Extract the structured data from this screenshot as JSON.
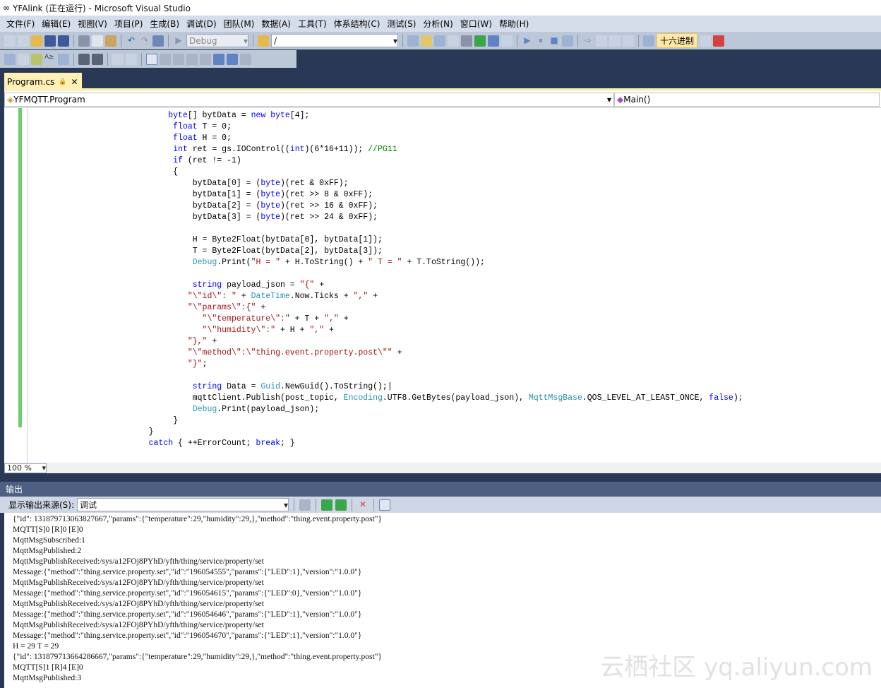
{
  "window": {
    "title": "YFAlink (正在运行) - Microsoft Visual Studio"
  },
  "menu": [
    "文件(F)",
    "编辑(E)",
    "视图(V)",
    "项目(P)",
    "生成(B)",
    "调试(D)",
    "团队(M)",
    "数据(A)",
    "工具(T)",
    "体系结构(C)",
    "测试(S)",
    "分析(N)",
    "窗口(W)",
    "帮助(H)"
  ],
  "toolbar": {
    "config": "Debug",
    "find": "/",
    "hex_label": "十六进制"
  },
  "tab": {
    "label": "Program.cs"
  },
  "navbar": {
    "class": "YFMQTT.Program",
    "member": "Main()"
  },
  "editor": {
    "zoom": "100 %",
    "lines": [
      [
        [
          "                            "
        ],
        [
          "byte",
          "kw"
        ],
        [
          "[] bytData = "
        ],
        [
          "new",
          "kw"
        ],
        [
          " "
        ],
        [
          "byte",
          "kw"
        ],
        [
          "[4];"
        ]
      ],
      [
        [
          "                             "
        ],
        [
          "float",
          "kw"
        ],
        [
          " T = 0;"
        ]
      ],
      [
        [
          "                             "
        ],
        [
          "float",
          "kw"
        ],
        [
          " H = 0;"
        ]
      ],
      [
        [
          "                             "
        ],
        [
          "int",
          "kw"
        ],
        [
          " ret = gs.IOControl(("
        ],
        [
          "int",
          "kw"
        ],
        [
          ")(6*16+11)); "
        ],
        [
          "//PG11",
          "cm"
        ]
      ],
      [
        [
          "                             "
        ],
        [
          "if",
          "kw"
        ],
        [
          " (ret != -1)"
        ]
      ],
      [
        [
          "                             {"
        ]
      ],
      [
        [
          "                                 bytData[0] = ("
        ],
        [
          "byte",
          "kw"
        ],
        [
          ")(ret & 0xFF);"
        ]
      ],
      [
        [
          "                                 bytData[1] = ("
        ],
        [
          "byte",
          "kw"
        ],
        [
          ")(ret >> 8 & 0xFF);"
        ]
      ],
      [
        [
          "                                 bytData[2] = ("
        ],
        [
          "byte",
          "kw"
        ],
        [
          ")(ret >> 16 & 0xFF);"
        ]
      ],
      [
        [
          "                                 bytData[3] = ("
        ],
        [
          "byte",
          "kw"
        ],
        [
          ")(ret >> 24 & 0xFF);"
        ]
      ],
      [
        [
          ""
        ]
      ],
      [
        [
          "                                 H = Byte2Float(bytData[0], bytData[1]);"
        ]
      ],
      [
        [
          "                                 T = Byte2Float(bytData[2], bytData[3]);"
        ]
      ],
      [
        [
          "                                 "
        ],
        [
          "Debug",
          "ty"
        ],
        [
          ".Print("
        ],
        [
          "\"H = \"",
          "str"
        ],
        [
          " + H.ToString() + "
        ],
        [
          "\" T = \"",
          "str"
        ],
        [
          " + T.ToString());"
        ]
      ],
      [
        [
          ""
        ]
      ],
      [
        [
          "                                 "
        ],
        [
          "string",
          "kw"
        ],
        [
          " payload_json = "
        ],
        [
          "\"{\"",
          "str"
        ],
        [
          " +"
        ]
      ],
      [
        [
          "                                "
        ],
        [
          "\"\\\"id\\\": \"",
          "str"
        ],
        [
          " + "
        ],
        [
          "DateTime",
          "ty"
        ],
        [
          ".Now.Ticks + "
        ],
        [
          "\",\"",
          "str"
        ],
        [
          " +"
        ]
      ],
      [
        [
          "                                "
        ],
        [
          "\"\\\"params\\\":{\"",
          "str"
        ],
        [
          " +"
        ]
      ],
      [
        [
          "                                   "
        ],
        [
          "\"\\\"temperature\\\":\"",
          "str"
        ],
        [
          " + T + "
        ],
        [
          "\",\"",
          "str"
        ],
        [
          " +"
        ]
      ],
      [
        [
          "                                   "
        ],
        [
          "\"\\\"humidity\\\":\"",
          "str"
        ],
        [
          " + H + "
        ],
        [
          "\",\"",
          "str"
        ],
        [
          " +"
        ]
      ],
      [
        [
          "                                "
        ],
        [
          "\"},\"",
          "str"
        ],
        [
          " +"
        ]
      ],
      [
        [
          "                                "
        ],
        [
          "\"\\\"method\\\":\\\"thing.event.property.post\\\"\"",
          "str"
        ],
        [
          " +"
        ]
      ],
      [
        [
          "                                "
        ],
        [
          "\"}\"",
          "str"
        ],
        [
          ";"
        ]
      ],
      [
        [
          ""
        ]
      ],
      [
        [
          "                                 "
        ],
        [
          "string",
          "kw"
        ],
        [
          " Data = "
        ],
        [
          "Guid",
          "ty"
        ],
        [
          ".NewGuid().ToString();|"
        ]
      ],
      [
        [
          "                                 mqttClient.Publish(post_topic, "
        ],
        [
          "Encoding",
          "ty"
        ],
        [
          ".UTF8.GetBytes(payload_json), "
        ],
        [
          "MqttMsgBase",
          "ty"
        ],
        [
          ".QOS_LEVEL_AT_LEAST_ONCE, "
        ],
        [
          "false",
          "kw"
        ],
        [
          ");"
        ]
      ],
      [
        [
          "                                 "
        ],
        [
          "Debug",
          "ty"
        ],
        [
          ".Print(payload_json);"
        ]
      ],
      [
        [
          "                             }"
        ]
      ],
      [
        [
          "                        }"
        ]
      ],
      [
        [
          "                        "
        ],
        [
          "catch",
          "kw"
        ],
        [
          " { ++ErrorCount; "
        ],
        [
          "break",
          "kw"
        ],
        [
          "; }"
        ]
      ]
    ]
  },
  "output": {
    "title": "输出",
    "source_label": "显示输出来源(S):",
    "source_value": "调试",
    "lines": [
      "{\"id\": 131879713063827667,\"params\":{\"temperature\":29,\"humidity\":29,},\"method\":\"thing.event.property.post\"}",
      "MQTT[S]0 [R]0 [E]0",
      "MqttMsgSubscribed:1",
      "MqttMsgPublished:2",
      "MqttMsgPublishReceived:/sys/a12FOj8PYhD/yfth/thing/service/property/set",
      "Message:{\"method\":\"thing.service.property.set\",\"id\":\"196054555\",\"params\":{\"LED\":1},\"version\":\"1.0.0\"}",
      "MqttMsgPublishReceived:/sys/a12FOj8PYhD/yfth/thing/service/property/set",
      "Message:{\"method\":\"thing.service.property.set\",\"id\":\"196054615\",\"params\":{\"LED\":0},\"version\":\"1.0.0\"}",
      "MqttMsgPublishReceived:/sys/a12FOj8PYhD/yfth/thing/service/property/set",
      "Message:{\"method\":\"thing.service.property.set\",\"id\":\"196054646\",\"params\":{\"LED\":1},\"version\":\"1.0.0\"}",
      "MqttMsgPublishReceived:/sys/a12FOj8PYhD/yfth/thing/service/property/set",
      "Message:{\"method\":\"thing.service.property.set\",\"id\":\"196054670\",\"params\":{\"LED\":1},\"version\":\"1.0.0\"}",
      "H = 29 T = 29",
      "{\"id\": 131879713664286667,\"params\":{\"temperature\":29,\"humidity\":29,},\"method\":\"thing.event.property.post\"}",
      "MQTT[S]1 [R]4 [E]0",
      "MqttMsgPublished:3"
    ]
  },
  "watermark": "云栖社区 yq.aliyun.com"
}
